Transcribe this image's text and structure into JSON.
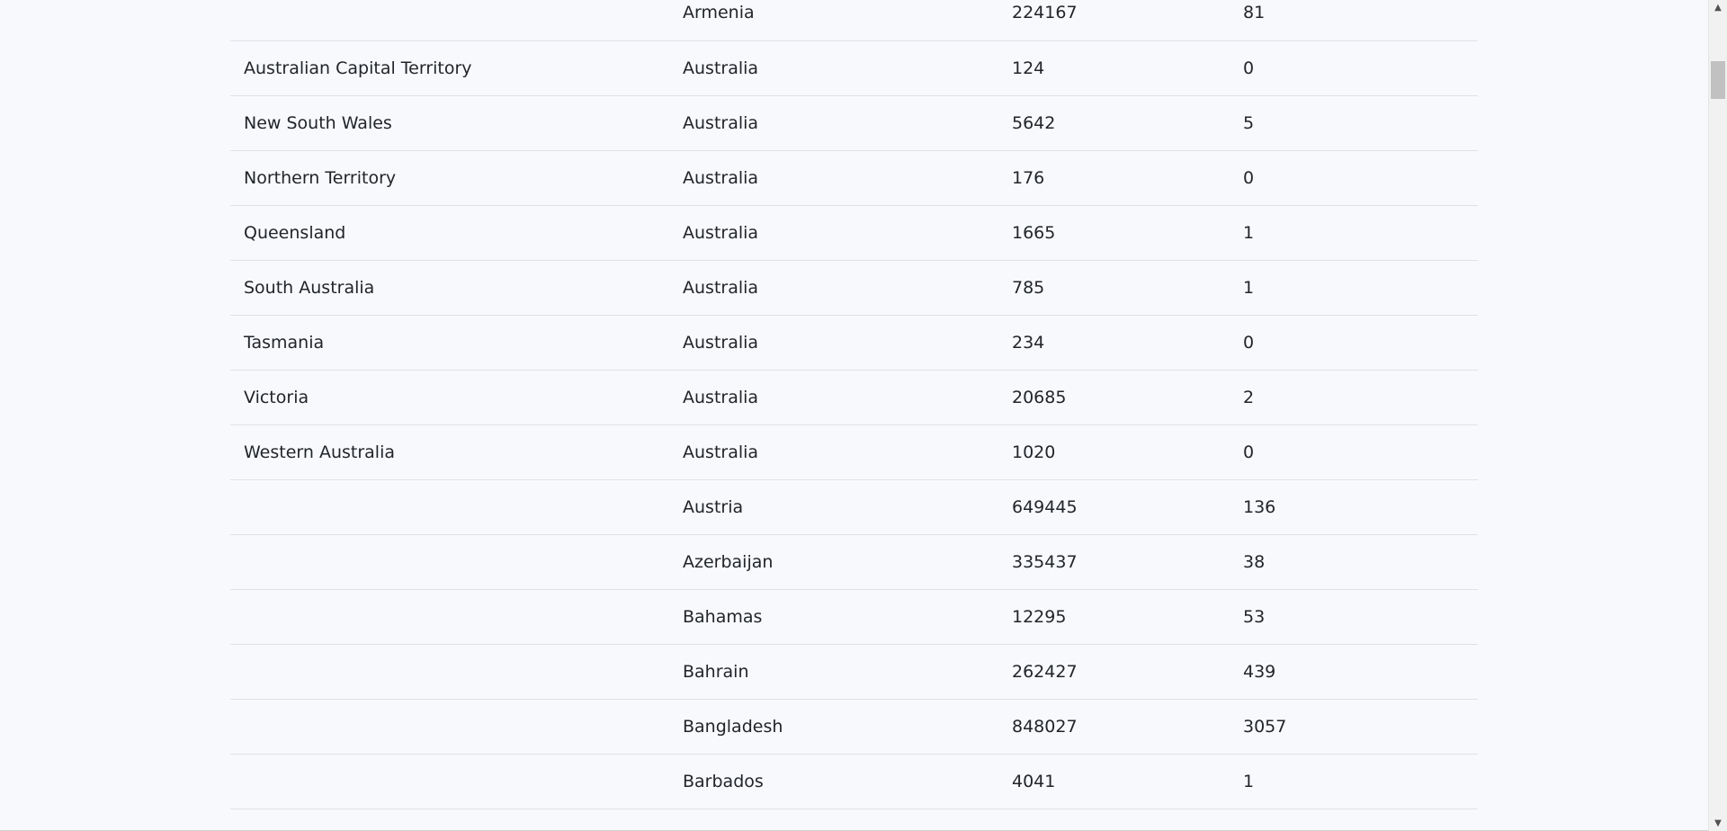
{
  "table": {
    "rows": [
      {
        "province": "",
        "country": "Armenia",
        "confirmed": "224167",
        "deaths": "81"
      },
      {
        "province": "Australian Capital Territory",
        "country": "Australia",
        "confirmed": "124",
        "deaths": "0"
      },
      {
        "province": "New South Wales",
        "country": "Australia",
        "confirmed": "5642",
        "deaths": "5"
      },
      {
        "province": "Northern Territory",
        "country": "Australia",
        "confirmed": "176",
        "deaths": "0"
      },
      {
        "province": "Queensland",
        "country": "Australia",
        "confirmed": "1665",
        "deaths": "1"
      },
      {
        "province": "South Australia",
        "country": "Australia",
        "confirmed": "785",
        "deaths": "1"
      },
      {
        "province": "Tasmania",
        "country": "Australia",
        "confirmed": "234",
        "deaths": "0"
      },
      {
        "province": "Victoria",
        "country": "Australia",
        "confirmed": "20685",
        "deaths": "2"
      },
      {
        "province": "Western Australia",
        "country": "Australia",
        "confirmed": "1020",
        "deaths": "0"
      },
      {
        "province": "",
        "country": "Austria",
        "confirmed": "649445",
        "deaths": "136"
      },
      {
        "province": "",
        "country": "Azerbaijan",
        "confirmed": "335437",
        "deaths": "38"
      },
      {
        "province": "",
        "country": "Bahamas",
        "confirmed": "12295",
        "deaths": "53"
      },
      {
        "province": "",
        "country": "Bahrain",
        "confirmed": "262427",
        "deaths": "439"
      },
      {
        "province": "",
        "country": "Bangladesh",
        "confirmed": "848027",
        "deaths": "3057"
      },
      {
        "province": "",
        "country": "Barbados",
        "confirmed": "4041",
        "deaths": "1"
      }
    ]
  },
  "scrollbar": {
    "up_icon": "scroll-up-arrow-icon",
    "down_icon": "scroll-down-arrow-icon",
    "up_glyph": "▲",
    "down_glyph": "▼"
  }
}
